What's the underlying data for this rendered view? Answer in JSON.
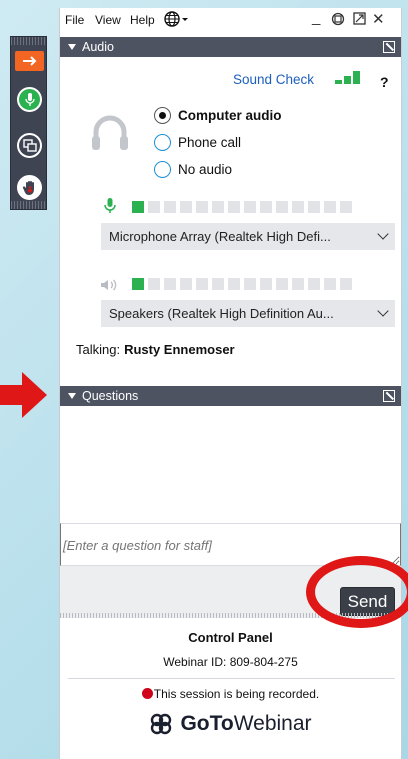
{
  "menu": {
    "file": "File",
    "view": "View",
    "help": "Help"
  },
  "window_controls": {
    "minimize": "_",
    "popout": "⧉",
    "restore": "⧄",
    "close": "✕"
  },
  "audio": {
    "section_title": "Audio",
    "sound_check": "Sound Check",
    "help": "?",
    "options": [
      {
        "label": "Computer audio",
        "selected": true
      },
      {
        "label": "Phone call",
        "selected": false
      },
      {
        "label": "No audio",
        "selected": false
      }
    ],
    "microphone_device": "Microphone Array (Realtek High Defi...",
    "speaker_device": "Speakers (Realtek High Definition Au...",
    "mic_level": 1,
    "speaker_level": 1,
    "meter_segments": 14,
    "talking_label": "Talking:",
    "talking_name": "Rusty Ennemoser"
  },
  "questions": {
    "section_title": "Questions",
    "input_placeholder": "[Enter a question for staff]",
    "send_label": "Send"
  },
  "footer": {
    "title": "Control Panel",
    "webinar_id": "Webinar ID: 809-804-275",
    "recording_text": "This session is being recorded.",
    "brand_bold": "GoTo",
    "brand_light": "Webinar"
  },
  "colors": {
    "accent_orange": "#f26522",
    "mic_green": "#2bb14f",
    "section_bar": "#4d5360",
    "link_blue": "#1c5fbd",
    "record_red": "#d0021b",
    "annotation_red": "#e01717"
  },
  "icons": [
    "arrow-right-icon",
    "microphone-icon",
    "screen-share-icon",
    "raise-hand-icon",
    "globe-icon",
    "headset-icon",
    "speaker-icon",
    "signal-icon",
    "gotowebinar-logo-icon"
  ]
}
